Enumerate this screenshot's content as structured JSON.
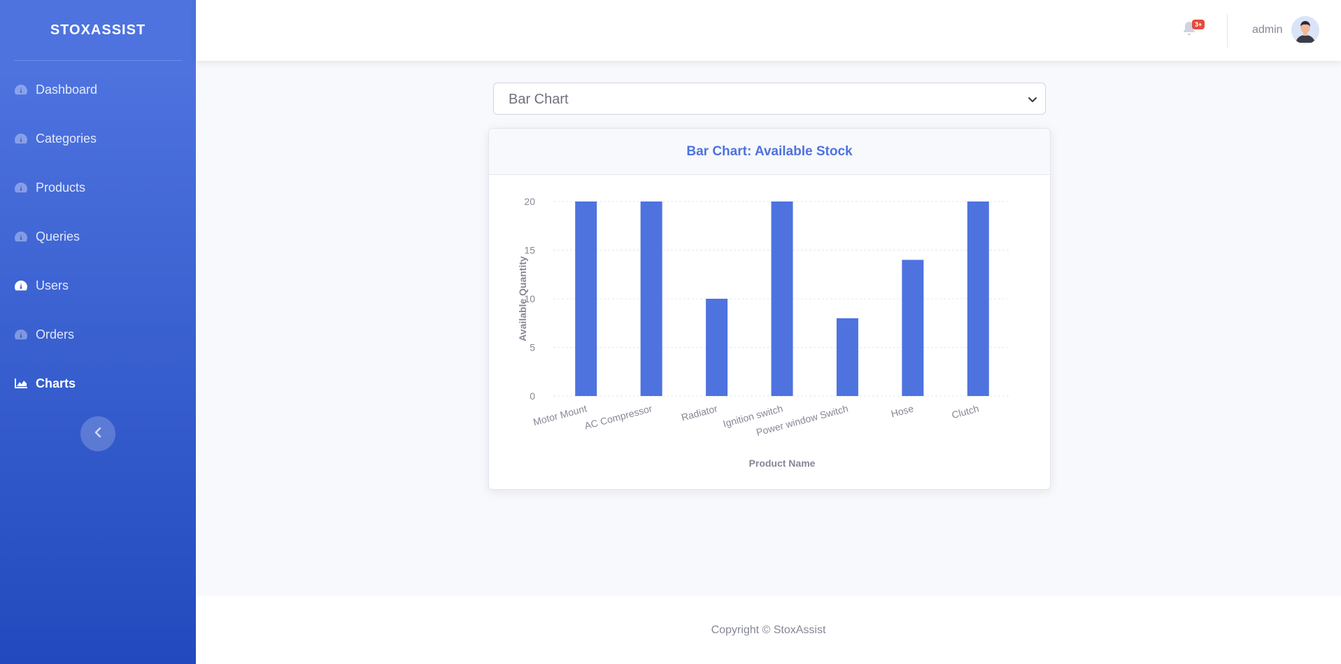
{
  "sidebar": {
    "brand": "STOXASSIST",
    "items": [
      {
        "label": "Dashboard",
        "icon": "tachometer-icon"
      },
      {
        "label": "Categories",
        "icon": "tachometer-icon"
      },
      {
        "label": "Products",
        "icon": "tachometer-icon"
      },
      {
        "label": "Queries",
        "icon": "tachometer-icon"
      },
      {
        "label": "Users",
        "icon": "tachometer-icon"
      },
      {
        "label": "Orders",
        "icon": "tachometer-icon"
      },
      {
        "label": "Charts",
        "icon": "area-chart-icon"
      }
    ],
    "toggle_icon": "chevron-left-icon"
  },
  "topbar": {
    "alert_badge": "3+",
    "user_name": "admin"
  },
  "chart_select": {
    "selected": "Bar Chart"
  },
  "card": {
    "title": "Bar Chart: Available Stock"
  },
  "chart_data": {
    "type": "bar",
    "title": "Bar Chart: Available Stock",
    "categories": [
      "Motor Mount",
      "AC Compressor",
      "Radiator",
      "Ignition switch",
      "Power window Switch",
      "Hose",
      "Clutch"
    ],
    "values": [
      20,
      20,
      10,
      20,
      8,
      14,
      20
    ],
    "xlabel": "Product Name",
    "ylabel": "Available Quantity",
    "ylim": [
      0,
      20
    ],
    "yticks": [
      0,
      5,
      10,
      15,
      20
    ],
    "grid": true,
    "bar_color": "#4e73df"
  },
  "footer": {
    "copyright": "Copyright © StoxAssist"
  },
  "colors": {
    "primary": "#4e73df",
    "sidebar_end": "#224abe",
    "danger": "#e74a3b",
    "muted": "#858796"
  }
}
